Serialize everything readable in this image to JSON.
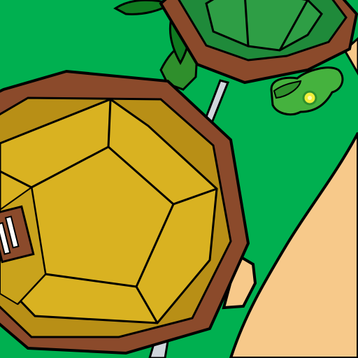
{
  "scene": {
    "type": "top-down game map",
    "colors": {
      "grass": "#00b050",
      "sand": "#f7c98a",
      "roof_wall": "#8b4a2b",
      "roof_gold": "#d9b221",
      "roof_gold_dark": "#b88f16",
      "roof_green": "#2e9e45",
      "roof_green_dark": "#1f8a3a",
      "bush": "#45b23e",
      "bush_dark": "#2f8f2c",
      "fence_post": "#cfd6dc",
      "leaf": "#0f7a20",
      "flower": "#f1ee3a",
      "outline": "#000000"
    },
    "objects": [
      {
        "name": "octagonal-hut-gold-roof"
      },
      {
        "name": "octagonal-hut-green-roof"
      },
      {
        "name": "sand-path"
      },
      {
        "name": "palm-tree"
      },
      {
        "name": "hedge-bush"
      },
      {
        "name": "yellow-flower"
      },
      {
        "name": "fence-post"
      },
      {
        "name": "window-shutter"
      }
    ]
  }
}
